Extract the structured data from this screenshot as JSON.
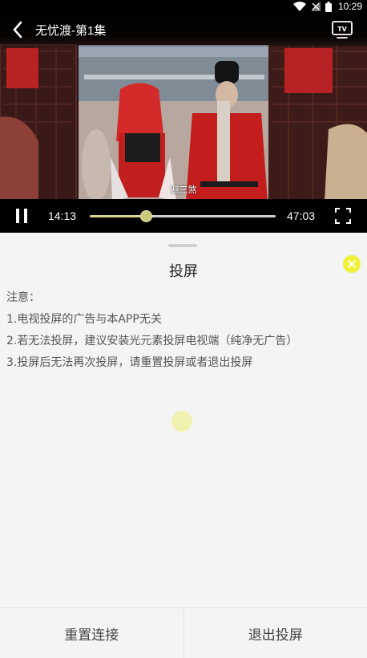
{
  "status_bar": {
    "time": "10:29"
  },
  "player": {
    "title": "无忧渡-第1集",
    "subtitle": "避三煞",
    "current_time": "14:13",
    "total_time": "47:03",
    "progress": 0.3
  },
  "cast_panel": {
    "title": "投屏",
    "notes": [
      "注意：",
      "1.电视投屏的广告与本APP无关",
      "2.若无法投屏，建议安装光元素投屏电视端（纯净无广告）",
      "3.投屏后无法再次投屏，请重置投屏或者退出投屏"
    ],
    "reset_label": "重置连接",
    "exit_label": "退出投屏"
  },
  "colors": {
    "accent": "#eef03a",
    "seek_thumb": "#c9c77a"
  },
  "icons": [
    "back-icon",
    "tv-cast-icon",
    "pause-icon",
    "fullscreen-icon",
    "close-icon",
    "wifi-icon",
    "signal-icon",
    "battery-icon"
  ]
}
